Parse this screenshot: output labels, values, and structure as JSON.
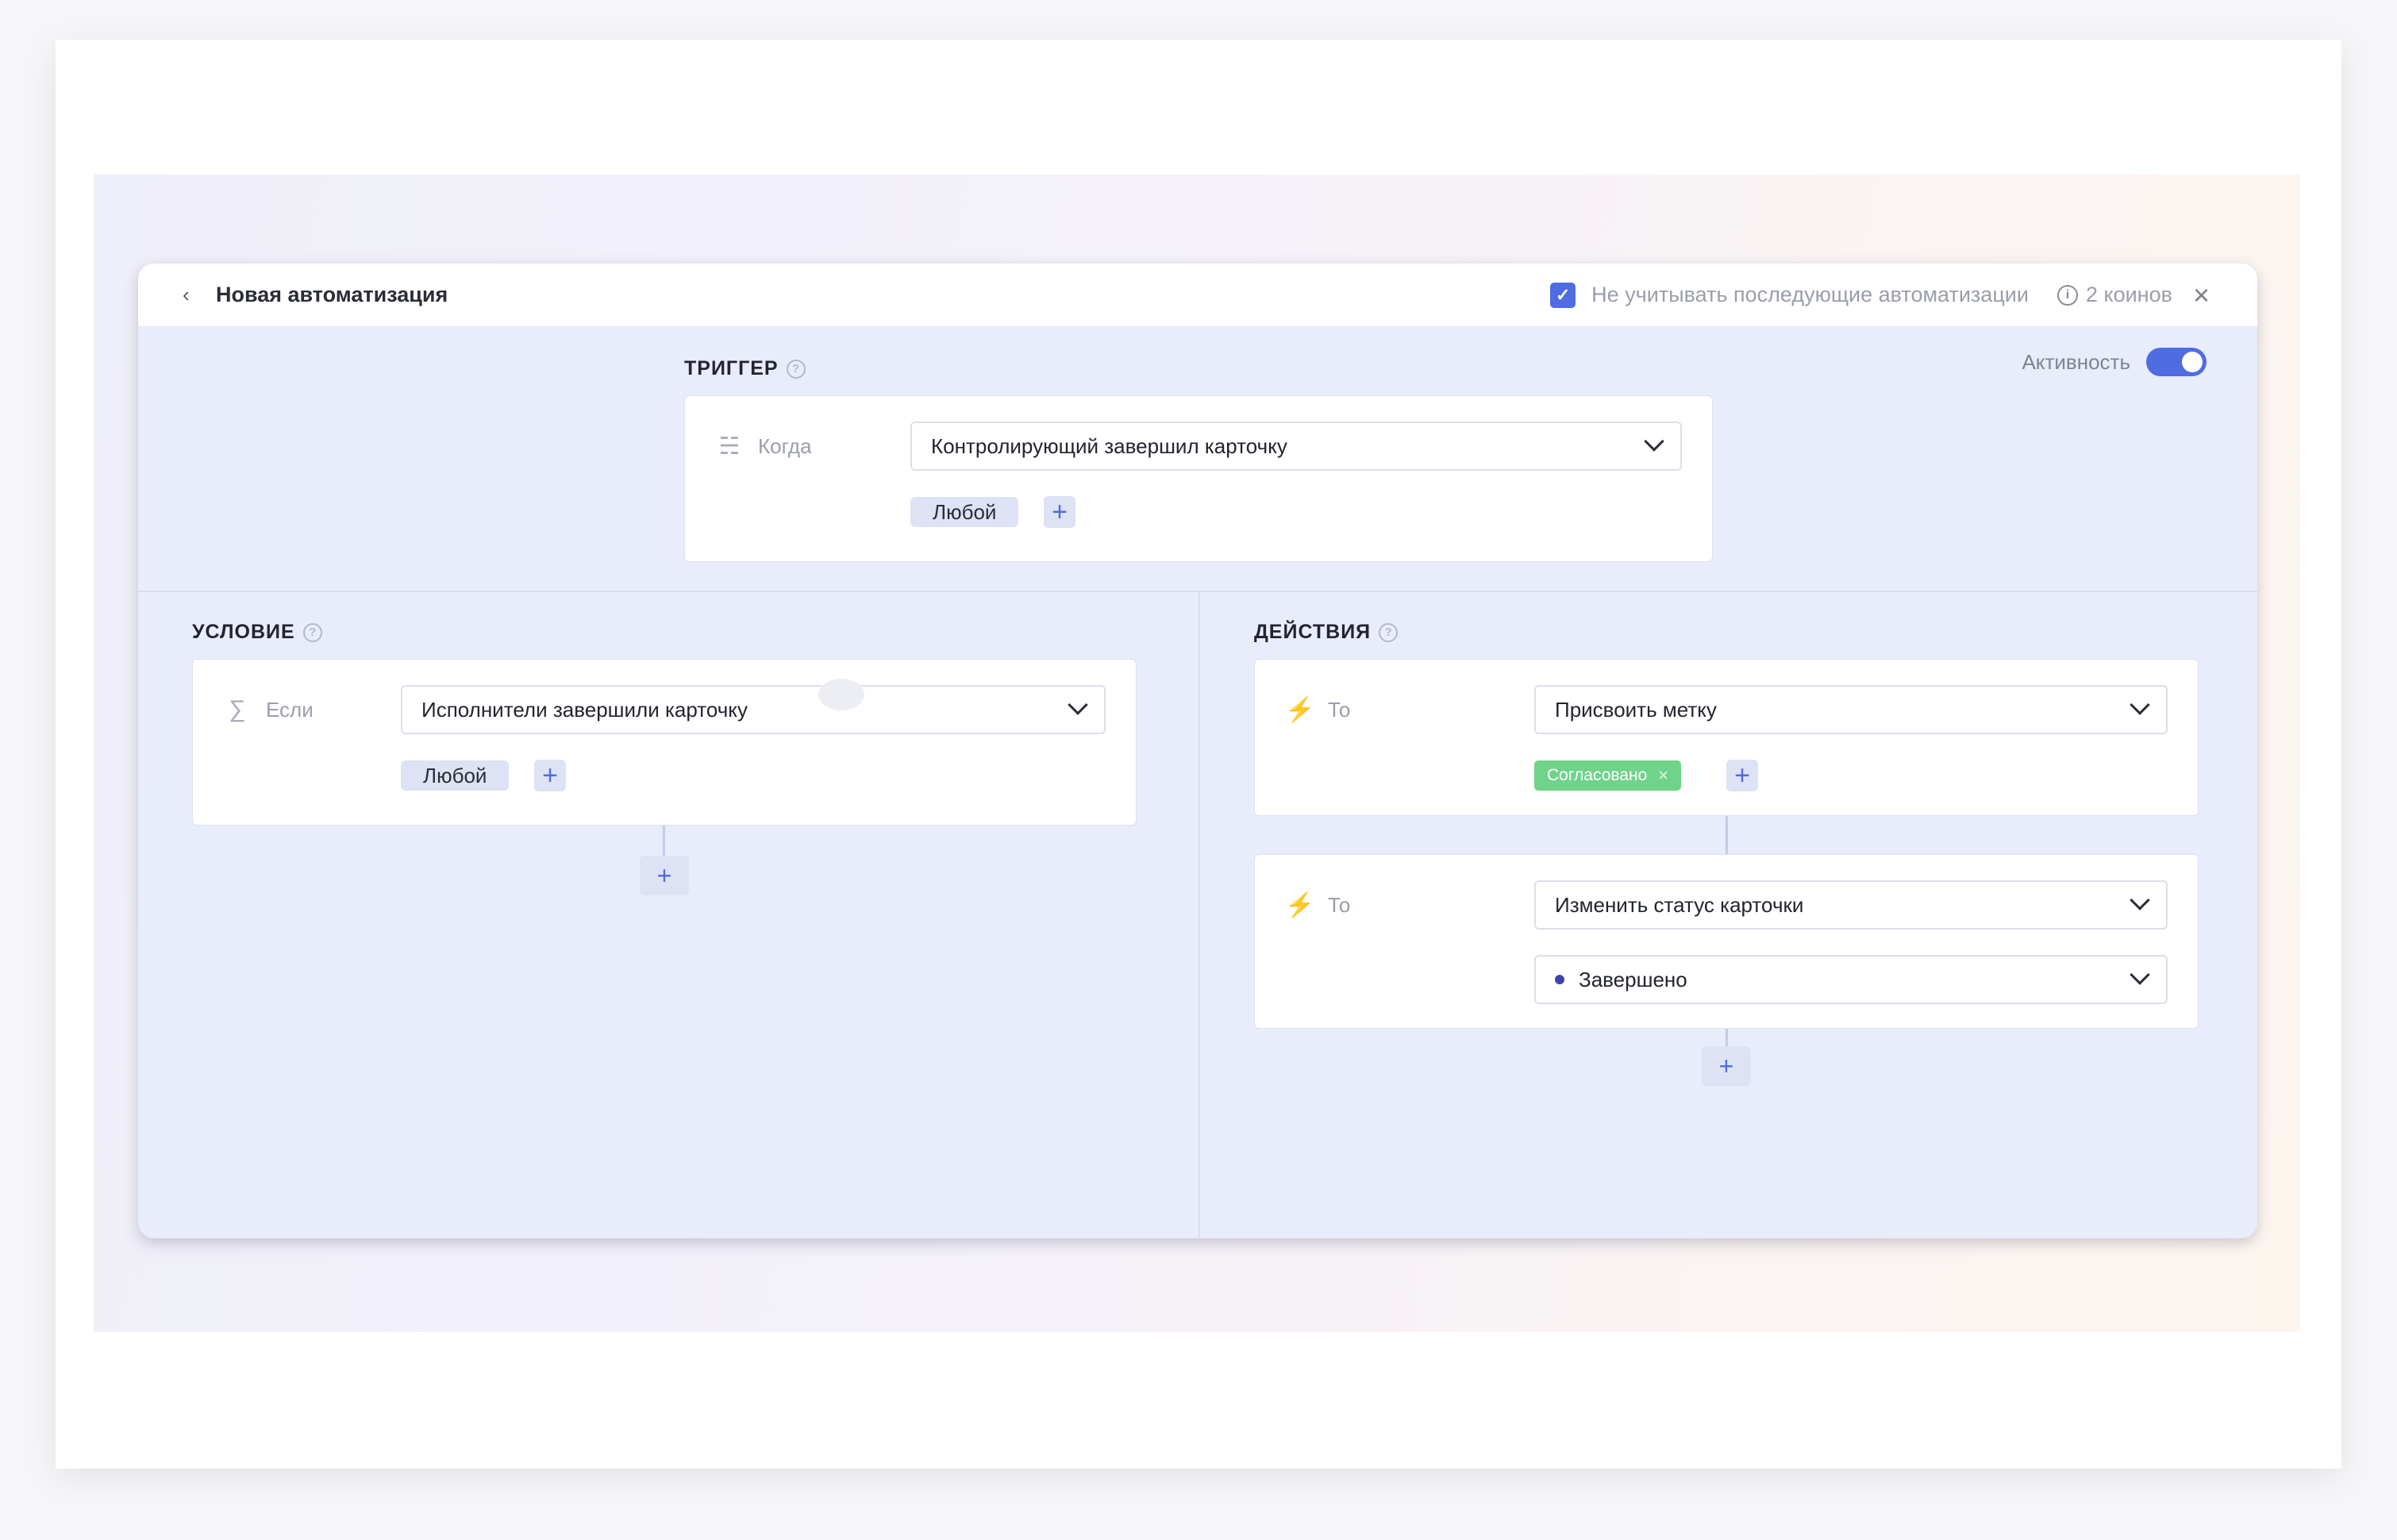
{
  "header": {
    "back_icon": "chevron-left-icon",
    "title": "Новая автоматизация",
    "checkbox_checked": true,
    "checkbox_label": "Не учитывать последующие автоматизации",
    "coins": "2 коинов",
    "close_icon": "close-icon"
  },
  "activity": {
    "label": "Активность",
    "on": true
  },
  "trigger": {
    "title": "ТРИГГЕР",
    "row_label": "Когда",
    "row_icon": "trigger-icon",
    "select_value": "Контролирующий завершил карточку",
    "chip": "Любой",
    "plus": "+"
  },
  "condition": {
    "title": "УСЛОВИЕ",
    "row_label": "Если",
    "row_icon": "sigma-icon",
    "select_value": "Исполнители завершили карточку",
    "chip": "Любой",
    "plus": "+",
    "add_step": "+"
  },
  "actions": {
    "title": "ДЕЙСТВИЯ",
    "items": [
      {
        "label": "То",
        "icon": "lightning-icon",
        "select_value": "Присвоить метку",
        "tag": "Согласовано",
        "tag_color": "#6fd38a",
        "plus": "+"
      },
      {
        "label": "То",
        "icon": "lightning-icon",
        "select_value": "Изменить статус карточки",
        "status_value": "Завершено",
        "status_color": "#3d43a8"
      }
    ],
    "add_step": "+"
  },
  "colors": {
    "accent": "#4f6de0",
    "panel": "#e8ecfb",
    "tag_green": "#6fd38a"
  }
}
